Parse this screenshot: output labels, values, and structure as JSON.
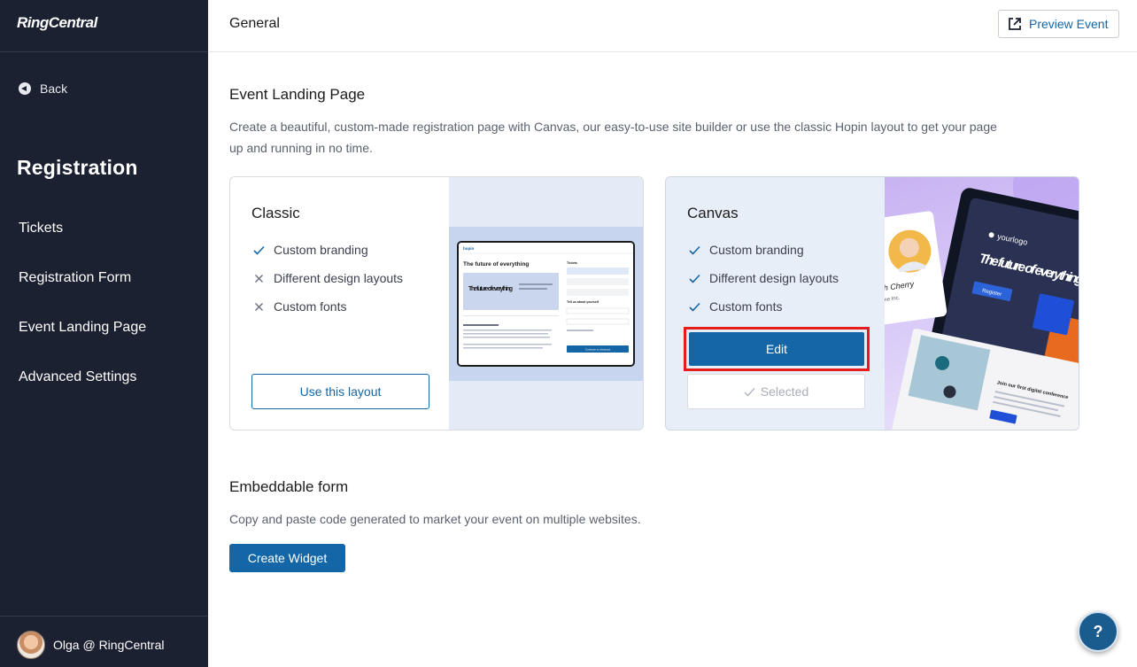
{
  "sidebar": {
    "logo": "RingCentral",
    "back_label": "Back",
    "section_title": "Registration",
    "items": [
      {
        "label": "Tickets"
      },
      {
        "label": "Registration Form"
      },
      {
        "label": "Event Landing Page"
      },
      {
        "label": "Advanced Settings"
      }
    ],
    "user_name": "Olga @ RingCentral"
  },
  "header": {
    "title": "General",
    "preview_label": "Preview Event"
  },
  "landing": {
    "heading": "Event Landing Page",
    "description_line1": "Create a beautiful, custom-made registration page with Canvas, our easy-to-use site builder or use the classic Hopin layout to get your page",
    "description_line2": "up and running in no time.",
    "classic": {
      "title": "Classic",
      "features": [
        {
          "label": "Custom branding",
          "icon": "check-icon"
        },
        {
          "label": "Different design layouts",
          "icon": "cross-icon"
        },
        {
          "label": "Custom fonts",
          "icon": "cross-icon"
        }
      ],
      "button_label": "Use this layout",
      "preview": {
        "brand": "hopin",
        "headline": "The future of everything",
        "hero_text": "The future of everything",
        "panel_title": "Tickets",
        "panel_question": "Tell us about yourself",
        "cta": "Continue to checkout"
      }
    },
    "canvas": {
      "title": "Canvas",
      "features": [
        {
          "label": "Custom branding",
          "icon": "check-icon"
        },
        {
          "label": "Different design layouts",
          "icon": "check-icon"
        },
        {
          "label": "Custom fonts",
          "icon": "check-icon"
        }
      ],
      "edit_label": "Edit",
      "selected_label": "Selected",
      "preview": {
        "logo_text": "yourlogo",
        "headline": "The future of everything",
        "register": "Register",
        "profile_name": "ah Cherry",
        "profile_org": "me Inc.",
        "footer_text": "Join our first digital conference"
      }
    }
  },
  "embed": {
    "heading": "Embeddable form",
    "description": "Copy and paste code generated to market your event on multiple websites.",
    "button_label": "Create Widget"
  },
  "help": {
    "label": "?"
  },
  "colors": {
    "sidebar_bg": "#1c2131",
    "accent": "#1466a6",
    "highlight": "#e61b1b"
  }
}
